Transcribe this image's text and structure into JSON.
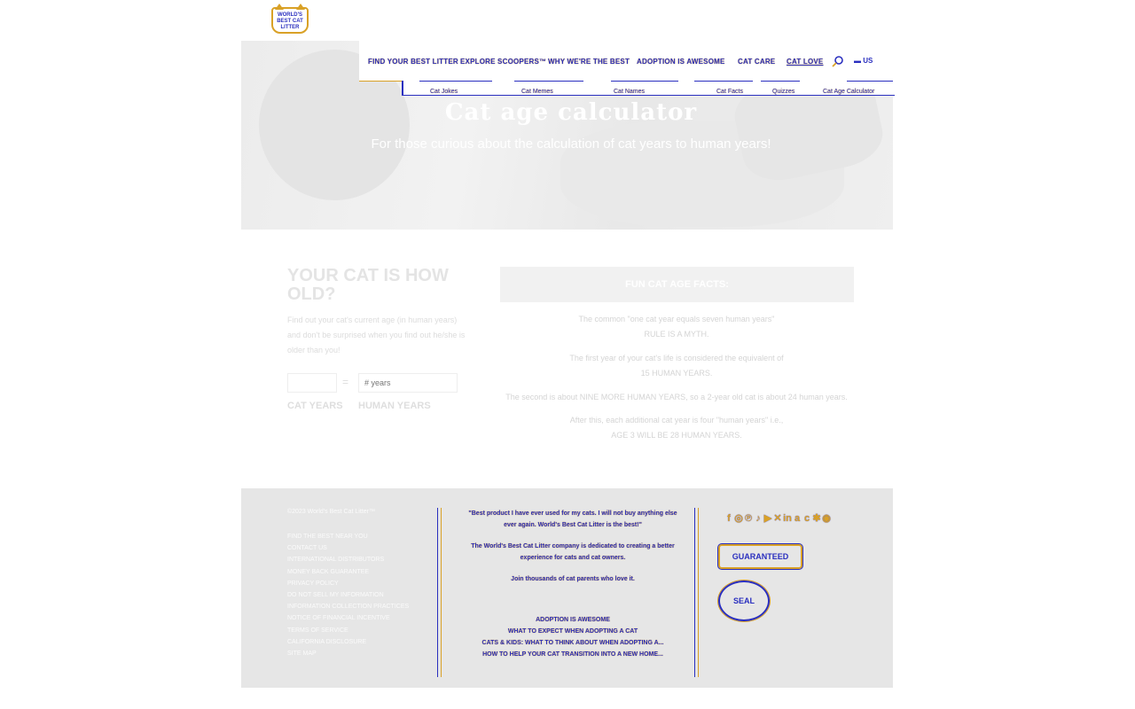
{
  "brand": {
    "logo_text": "WORLD'S BEST CAT LITTER"
  },
  "nav": {
    "items": [
      "FIND YOUR BEST LITTER",
      "EXPLORE SCOOPERS™",
      "WHY WE'RE THE BEST",
      "ADOPTION IS AWESOME",
      "CAT CARE",
      "CAT LOVE"
    ],
    "active": "CAT LOVE",
    "region": "US"
  },
  "subnav": {
    "items": [
      "Cat Jokes",
      "Cat Memes",
      "Cat Names",
      "Cat Facts",
      "Quizzes",
      "Cat Age Calculator"
    ]
  },
  "hero": {
    "title": "Cat age calculator",
    "subtitle": "For those curious about the calculation of cat years to human years!"
  },
  "calculator": {
    "title": "YOUR CAT IS HOW OLD?",
    "description": "Find out your cat's current age (in human years) and don't be surprised when you find out he/she is older than you!",
    "cat_years_value": "",
    "equals": "=",
    "human_years_placeholder": "# years",
    "cat_years_label": "CAT YEARS",
    "human_years_label": "HUMAN YEARS"
  },
  "facts": {
    "heading": "FUN CAT AGE FACTS:",
    "items": [
      [
        "The common \"one cat year equals seven human years\"",
        "RULE IS A MYTH."
      ],
      [
        "The first year of your cat's life is considered the equivalent of",
        "15 HUMAN YEARS."
      ],
      [
        "The second is about NINE MORE HUMAN YEARS, so a 2-year old cat is about 24 human years."
      ],
      [
        "After this, each additional cat year is four \"human years\" i.e.,",
        "AGE 3 WILL BE 28 HUMAN YEARS."
      ]
    ]
  },
  "footer": {
    "copyright": "©2023 World's Best Cat Litter™",
    "links": [
      "FIND THE BEST NEAR YOU",
      "CONTACT US",
      "INTERNATIONAL DISTRIBUTORS",
      "MONEY BACK GUARANTEE",
      "PRIVACY POLICY",
      "DO NOT SELL MY INFORMATION",
      "INFORMATION COLLECTION PRACTICES",
      "NOTICE OF FINANCIAL INCENTIVE",
      "TERMS OF SERVICE",
      "CALIFORNIA DISCLOSURE",
      "SITE MAP"
    ],
    "quotes": [
      "\"Best product I have ever used for my cats. I will not buy anything else ever again. World's Best Cat Litter is the best!\"",
      "The World's Best Cat Litter company is dedicated to creating a better experience for cats and cat owners.",
      "Join thousands of cat parents who love it."
    ],
    "articles": {
      "heading": "ADOPTION IS AWESOME",
      "items": [
        "WHAT TO EXPECT WHEN ADOPTING A CAT",
        "CATS & KIDS: WHAT TO THINK ABOUT WHEN ADOPTING A...",
        "HOW TO HELP YOUR CAT TRANSITION INTO A NEW HOME..."
      ]
    },
    "social_icons": [
      "facebook-icon",
      "instagram-icon",
      "pinterest-icon",
      "tiktok-icon",
      "youtube-icon",
      "twitter-icon",
      "linkedin-icon",
      "amazon-icon",
      "chewy-icon",
      "walmart-icon",
      "target-icon"
    ],
    "badge_guarantee": "GUARANTEED",
    "badge_seal": "SEAL"
  }
}
